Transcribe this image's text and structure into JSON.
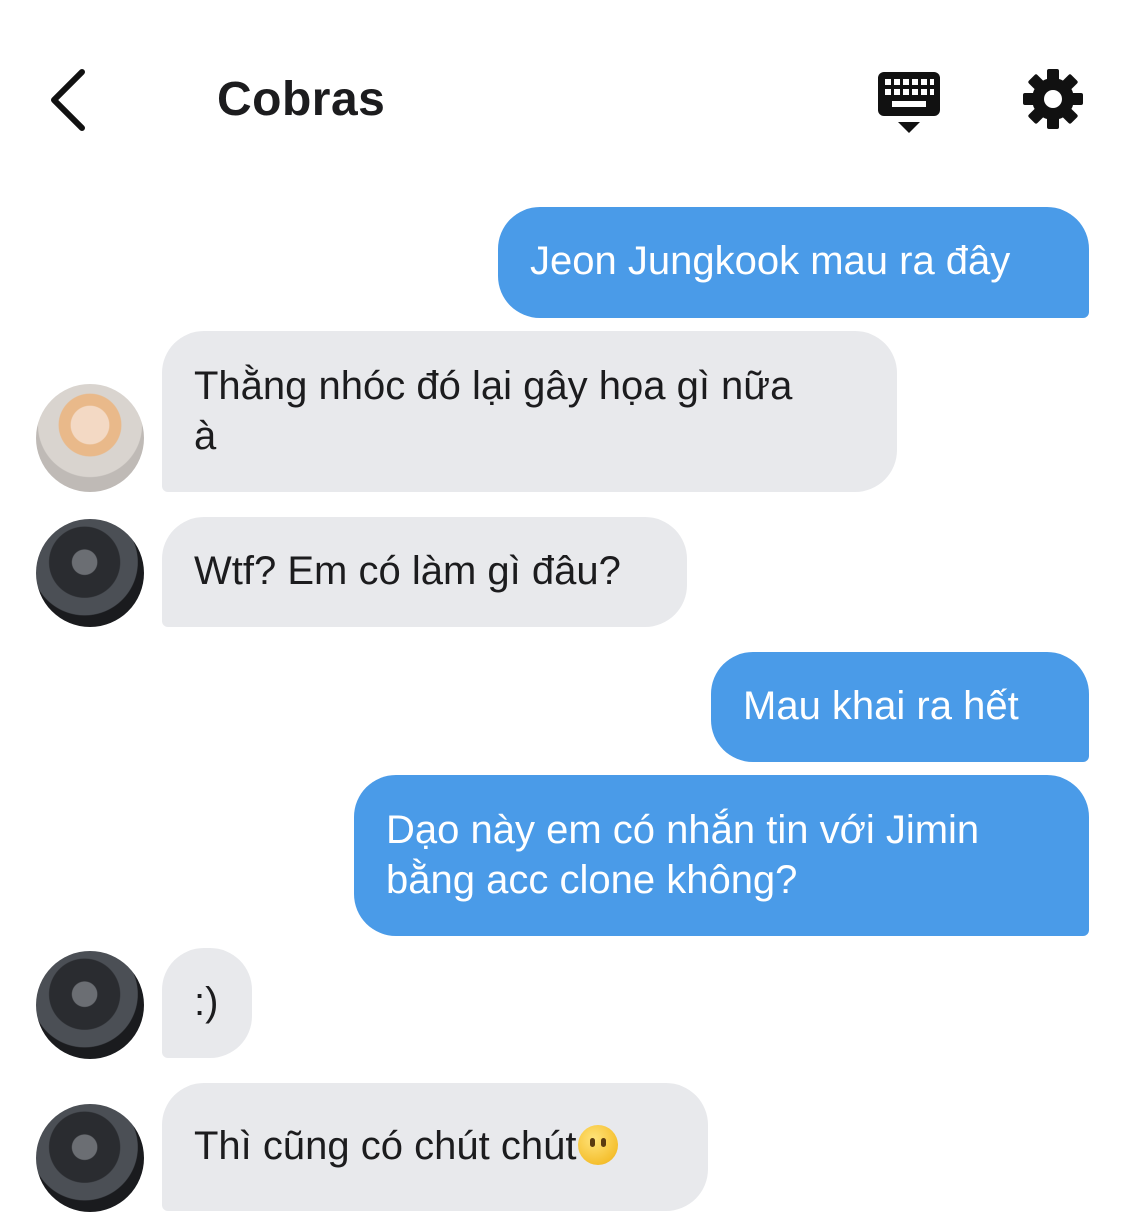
{
  "header": {
    "title": "Cobras",
    "back_icon": "chevron-left-icon",
    "keyboard_icon": "keyboard-icon",
    "settings_icon": "gear-icon"
  },
  "colors": {
    "outgoing_bubble": "#4a9be8",
    "incoming_bubble": "#e8e9ec",
    "text": "#1c1c1e"
  },
  "messages": [
    {
      "direction": "out",
      "text": "Jeon Jungkook mau ra đây"
    },
    {
      "direction": "in",
      "avatar": "avatar-light",
      "line1": "Thằng nhóc đó lại gây họa gì nữa",
      "line2": "à"
    },
    {
      "direction": "in",
      "avatar": "avatar-dark",
      "text": "Wtf? Em có làm gì đâu?"
    },
    {
      "direction": "out",
      "text": "Mau khai ra hết"
    },
    {
      "direction": "out",
      "line1": "Dạo này em có nhắn tin với Jimin",
      "line2": "bằng acc clone không?"
    },
    {
      "direction": "in",
      "avatar": "avatar-dark",
      "text": ":)"
    },
    {
      "direction": "in",
      "avatar": "avatar-dark",
      "text": "Thì cũng có chút chút",
      "emoji": "face-without-mouth-emoji"
    }
  ]
}
